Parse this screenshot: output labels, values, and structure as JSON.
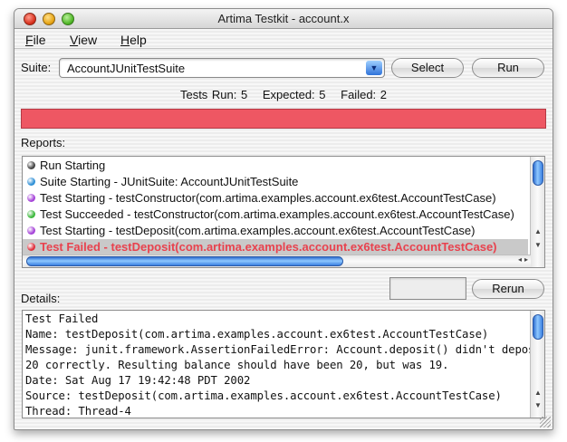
{
  "window": {
    "title": "Artima Testkit - account.x"
  },
  "menu": [
    {
      "underline": "F",
      "rest": "ile"
    },
    {
      "underline": "V",
      "rest": "iew"
    },
    {
      "underline": "H",
      "rest": "elp"
    }
  ],
  "suite": {
    "label": "Suite:",
    "selected": "AccountJUnitTestSuite",
    "select_button": "Select",
    "run_button": "Run"
  },
  "stats": {
    "tests_run": "Tests Run: 5",
    "expected": "Expected: 5",
    "failed": "Failed: 2"
  },
  "progress": {
    "status": "failed",
    "color": "#ee5763"
  },
  "reports": {
    "label": "Reports:",
    "items": [
      {
        "text": "Run Starting",
        "dot_color": "#444444"
      },
      {
        "text": "Suite Starting - JUnitSuite: AccountJUnitTestSuite",
        "dot_color": "#2e8fd6"
      },
      {
        "text": "Test Starting - testConstructor(com.artima.examples.account.ex6test.AccountTestCase)",
        "dot_color": "#a543d8"
      },
      {
        "text": "Test Succeeded - testConstructor(com.artima.examples.account.ex6test.AccountTestCase)",
        "dot_color": "#3cb83c"
      },
      {
        "text": "Test Starting - testDeposit(com.artima.examples.account.ex6test.AccountTestCase)",
        "dot_color": "#a543d8"
      },
      {
        "text": "Test Failed - testDeposit(com.artima.examples.account.ex6test.AccountTestCase)",
        "dot_color": "#e0303c",
        "selected": true
      }
    ]
  },
  "rerun_button": "Rerun",
  "details": {
    "label": "Details:",
    "lines": [
      "Test Failed",
      "Name: testDeposit(com.artima.examples.account.ex6test.AccountTestCase)",
      "Message: junit.framework.AssertionFailedError: Account.deposit() didn't deposit",
      "20 correctly. Resulting balance should have been 20, but was 19.",
      "Date: Sat Aug 17 19:42:48 PDT 2002",
      "Source: testDeposit(com.artima.examples.account.ex6test.AccountTestCase)",
      "Thread: Thread-4"
    ]
  }
}
